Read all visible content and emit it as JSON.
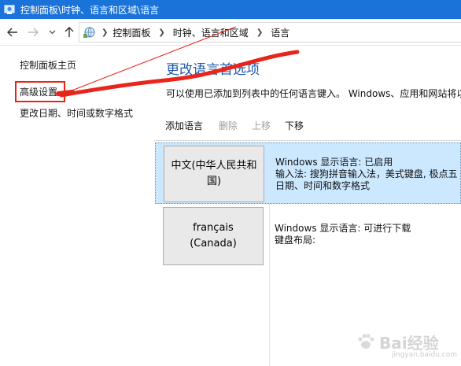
{
  "window": {
    "title": "控制面板\\时钟、语言和区域\\语言",
    "accent": "#1a73d9"
  },
  "nav": {
    "back_icon": "arrow-left-icon",
    "forward_icon": "arrow-right-icon",
    "up_icon": "arrow-up-icon",
    "breadcrumbs": [
      "控制面板",
      "时钟、语言和区域",
      "语言"
    ]
  },
  "sidebar": {
    "items": [
      {
        "label": "控制面板主页"
      },
      {
        "label": "高级设置",
        "highlighted": true
      },
      {
        "label": "更改日期、时间或数字格式"
      }
    ]
  },
  "main": {
    "heading": "更改语言首选项",
    "description": "可以使用已添加到列表中的任何语言键入。 Windows、应用和网站将以",
    "toolbar": {
      "add": "添加语言",
      "remove": "删除",
      "move_up": "上移",
      "move_down": "下移"
    },
    "languages": [
      {
        "name": "中文(中华人民共和国)",
        "selected": true,
        "info": [
          "Windows 显示语言: 已启用",
          "输入法: 搜狗拼音输入法，美式键盘, 极点五",
          "日期、时间和数字格式"
        ]
      },
      {
        "name": "français (Canada)",
        "selected": false,
        "info": [
          "Windows 显示语言: 可进行下载",
          "键盘布局:"
        ]
      }
    ]
  },
  "annotation": {
    "color": "#e8241b"
  },
  "watermark": {
    "text": "Bai经验",
    "sub": "jingyan.baidu.com"
  }
}
